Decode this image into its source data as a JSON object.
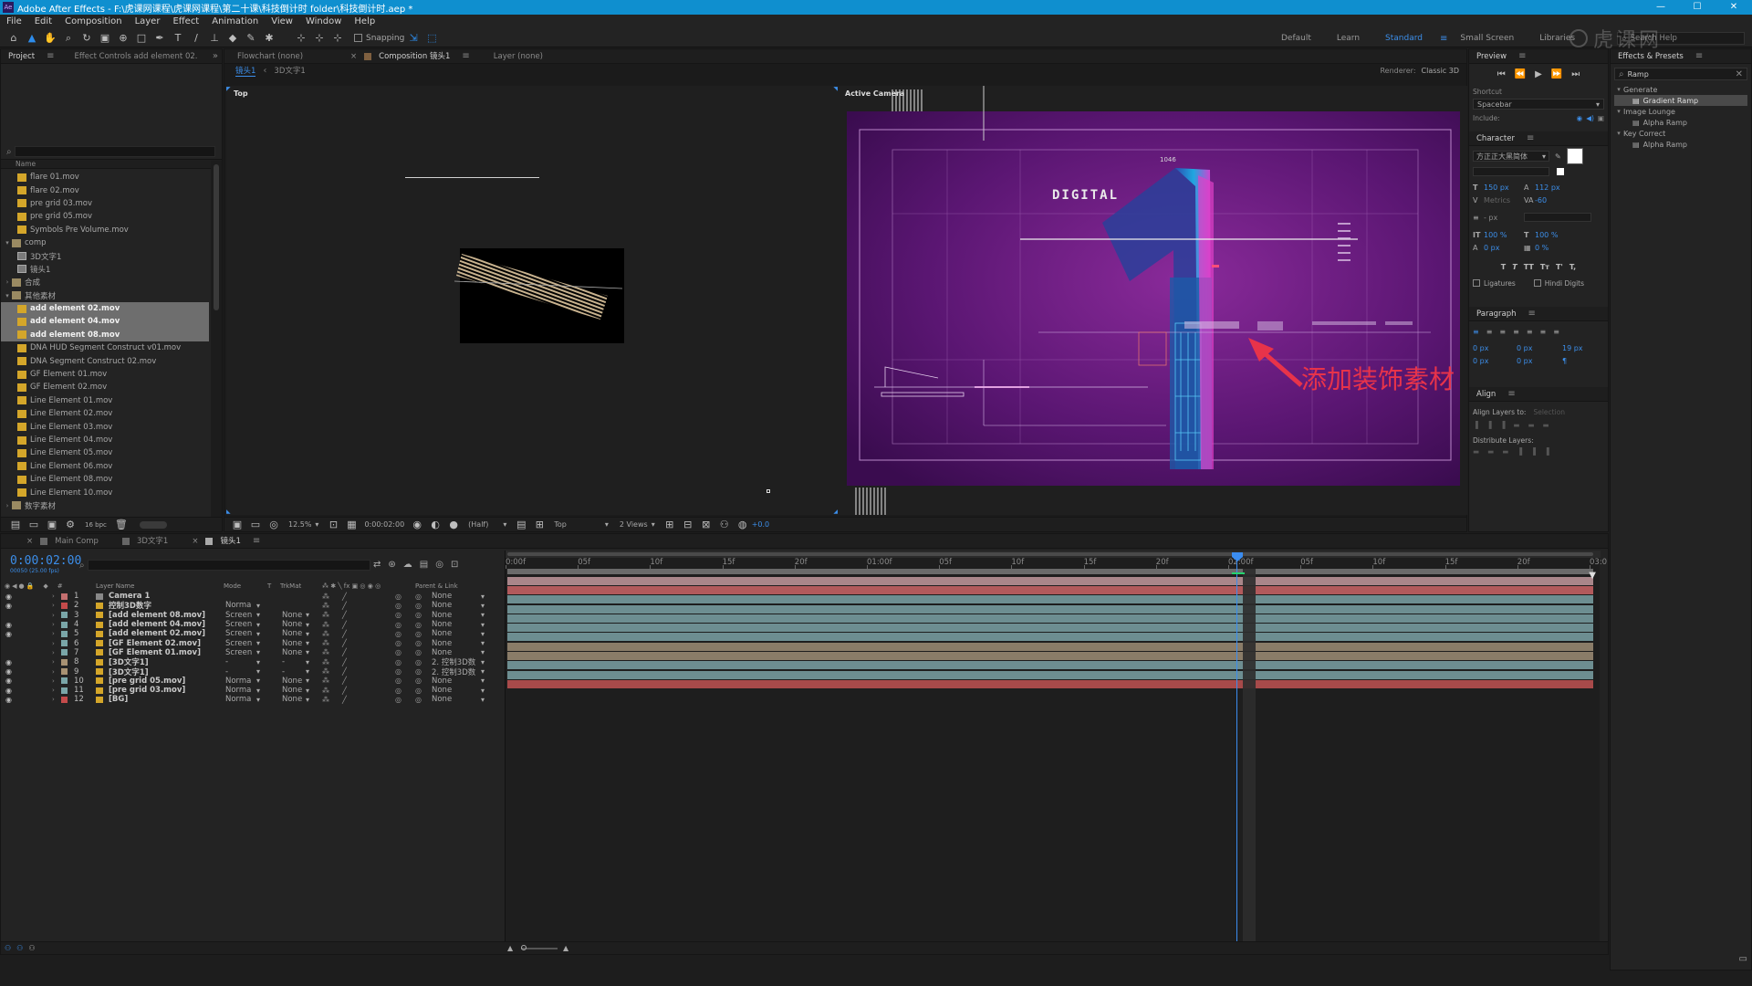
{
  "window": {
    "title": "Adobe After Effects - F:\\虎课网课程\\虎课网课程\\第二十课\\科技倒计时 folder\\科技倒计时.aep *",
    "app_badge": "Ae",
    "min": "—",
    "max": "☐",
    "close": "✕"
  },
  "menu": [
    "File",
    "Edit",
    "Composition",
    "Layer",
    "Effect",
    "Animation",
    "View",
    "Window",
    "Help"
  ],
  "toolbar": {
    "snapping_label": "Snapping",
    "workspaces": [
      "Default",
      "Learn",
      "Standard",
      "Small Screen",
      "Libraries"
    ],
    "active_workspace": "Standard",
    "search_help": "Search Help"
  },
  "project_panel": {
    "tabs": [
      "Project",
      "Effect Controls add element 02."
    ],
    "search_placeholder": "",
    "column_name": "Name",
    "items": [
      {
        "label": "flare 01.mov",
        "type": "mov",
        "indent": 2,
        "selected": false
      },
      {
        "label": "flare 02.mov",
        "type": "mov",
        "indent": 2,
        "selected": false
      },
      {
        "label": "pre grid 03.mov",
        "type": "mov",
        "indent": 2,
        "selected": false
      },
      {
        "label": "pre grid 05.mov",
        "type": "mov",
        "indent": 2,
        "selected": false
      },
      {
        "label": "Symbols Pre Volume.mov",
        "type": "mov",
        "indent": 2,
        "selected": false
      },
      {
        "label": "comp",
        "type": "folder",
        "indent": 0,
        "selected": false,
        "expanded": true
      },
      {
        "label": "3D文字1",
        "type": "comp",
        "indent": 2,
        "selected": false
      },
      {
        "label": "镜头1",
        "type": "comp",
        "indent": 2,
        "selected": false
      },
      {
        "label": "合成",
        "type": "folder",
        "indent": 0,
        "selected": false,
        "expanded": false
      },
      {
        "label": "其他素材",
        "type": "folder",
        "indent": 0,
        "selected": false,
        "expanded": true
      },
      {
        "label": "add element 02.mov",
        "type": "mov",
        "indent": 2,
        "selected": true
      },
      {
        "label": "add element 04.mov",
        "type": "mov",
        "indent": 2,
        "selected": true
      },
      {
        "label": "add element 08.mov",
        "type": "mov",
        "indent": 2,
        "selected": true
      },
      {
        "label": "DNA HUD Segment Construct v01.mov",
        "type": "mov",
        "indent": 2,
        "selected": false
      },
      {
        "label": "DNA Segment Construct 02.mov",
        "type": "mov",
        "indent": 2,
        "selected": false
      },
      {
        "label": "GF Element 01.mov",
        "type": "mov",
        "indent": 2,
        "selected": false
      },
      {
        "label": "GF Element 02.mov",
        "type": "mov",
        "indent": 2,
        "selected": false
      },
      {
        "label": "Line Element 01.mov",
        "type": "mov",
        "indent": 2,
        "selected": false
      },
      {
        "label": "Line Element 02.mov",
        "type": "mov",
        "indent": 2,
        "selected": false
      },
      {
        "label": "Line Element 03.mov",
        "type": "mov",
        "indent": 2,
        "selected": false
      },
      {
        "label": "Line Element 04.mov",
        "type": "mov",
        "indent": 2,
        "selected": false
      },
      {
        "label": "Line Element 05.mov",
        "type": "mov",
        "indent": 2,
        "selected": false
      },
      {
        "label": "Line Element 06.mov",
        "type": "mov",
        "indent": 2,
        "selected": false
      },
      {
        "label": "Line Element 08.mov",
        "type": "mov",
        "indent": 2,
        "selected": false
      },
      {
        "label": "Line Element 10.mov",
        "type": "mov",
        "indent": 2,
        "selected": false
      },
      {
        "label": "数字素材",
        "type": "folder",
        "indent": 0,
        "selected": false,
        "expanded": false
      }
    ],
    "bpc": "16 bpc"
  },
  "viewer": {
    "tabs": [
      "Flowchart (none)",
      "Composition 镜头1",
      "Layer (none)"
    ],
    "breadcrumbs": [
      "镜头1",
      "3D文字1"
    ],
    "renderer_label": "Renderer:",
    "renderer_value": "Classic 3D",
    "left_view_label": "Top",
    "right_view_label": "Active Camera",
    "digital_text": "DIGITAL",
    "hud_number": "1046",
    "annotation": "添加装饰素材",
    "footer": {
      "zoom": "12.5%",
      "timecode": "0:00:02:00",
      "resolution": "(Half)",
      "view": "Top",
      "views": "2 Views",
      "exposure": "+0.0"
    }
  },
  "timeline": {
    "tabs": [
      "Main Comp",
      "3D文字1",
      "镜头1"
    ],
    "timecode": "0:00:02:00",
    "timecode_sub": "00050 (25.00 fps)",
    "columns": {
      "layer_name": "Layer Name",
      "mode": "Mode",
      "t": "T",
      "trkmat": "TrkMat",
      "parent": "Parent & Link"
    },
    "ruler": [
      "0:00f",
      "05f",
      "10f",
      "15f",
      "20f",
      "01:00f",
      "05f",
      "10f",
      "15f",
      "20f",
      "02:00f",
      "05f",
      "10f",
      "15f",
      "20f",
      "03:0"
    ],
    "layers": [
      {
        "num": "1",
        "name": "Camera 1",
        "mode": "",
        "trkmat": "",
        "parent": "None",
        "color": "#c46f6f",
        "bar": "#a9868a",
        "visible": true
      },
      {
        "num": "2",
        "name": "控制3D数字",
        "mode": "Norma",
        "trkmat": "",
        "parent": "None",
        "color": "#c44b4b",
        "bar": "#b25a5c",
        "visible": true
      },
      {
        "num": "3",
        "name": "[add element 08.mov]",
        "mode": "Screen",
        "trkmat": "None",
        "parent": "None",
        "color": "#7aa6a8",
        "bar": "#6d8e91",
        "visible": false
      },
      {
        "num": "4",
        "name": "[add element 04.mov]",
        "mode": "Screen",
        "trkmat": "None",
        "parent": "None",
        "color": "#7aa6a8",
        "bar": "#6d8e91",
        "visible": true
      },
      {
        "num": "5",
        "name": "[add element 02.mov]",
        "mode": "Screen",
        "trkmat": "None",
        "parent": "None",
        "color": "#7aa6a8",
        "bar": "#6d8e91",
        "visible": true
      },
      {
        "num": "6",
        "name": "[GF Element 02.mov]",
        "mode": "Screen",
        "trkmat": "None",
        "parent": "None",
        "color": "#7aa6a8",
        "bar": "#6d8e91",
        "visible": false
      },
      {
        "num": "7",
        "name": "[GF Element 01.mov]",
        "mode": "Screen",
        "trkmat": "None",
        "parent": "None",
        "color": "#7aa6a8",
        "bar": "#6d8e91",
        "visible": false
      },
      {
        "num": "8",
        "name": "[3D文字1]",
        "mode": "-",
        "trkmat": "-",
        "parent": "2. 控制3D数",
        "color": "#a89273",
        "bar": "#8a7c68",
        "visible": true
      },
      {
        "num": "9",
        "name": "[3D文字1]",
        "mode": "-",
        "trkmat": "-",
        "parent": "2. 控制3D数",
        "color": "#a89273",
        "bar": "#8a7c68",
        "visible": true
      },
      {
        "num": "10",
        "name": "[pre grid 05.mov]",
        "mode": "Norma",
        "trkmat": "None",
        "parent": "None",
        "color": "#7aa6a8",
        "bar": "#6d8e91",
        "visible": true
      },
      {
        "num": "11",
        "name": "[pre grid 03.mov]",
        "mode": "Norma",
        "trkmat": "None",
        "parent": "None",
        "color": "#7aa6a8",
        "bar": "#6d8e91",
        "visible": true
      },
      {
        "num": "12",
        "name": "[BG]",
        "mode": "Norma",
        "trkmat": "None",
        "parent": "None",
        "color": "#c44b4b",
        "bar": "#a84a4a",
        "visible": true
      }
    ]
  },
  "preview": {
    "title": "Preview",
    "shortcut_label": "Shortcut",
    "shortcut_value": "Spacebar",
    "include_label": "Include:"
  },
  "character": {
    "title": "Character",
    "font": "方正正大黑简体",
    "size": "150 px",
    "leading": "112 px",
    "kerning": "Metrics",
    "tracking": "-60",
    "stroke": "- px",
    "vscale": "100 %",
    "hscale": "100 %",
    "baseline": "0 px",
    "tsume": "0 %",
    "styles": [
      "T",
      "T",
      "TT",
      "Tт",
      "T'",
      "T,"
    ],
    "ligatures": "Ligatures",
    "hindi": "Hindi Digits"
  },
  "paragraph": {
    "title": "Paragraph",
    "v1": "0 px",
    "v2": "0 px",
    "v3": "19 px",
    "v4": "0 px",
    "v5": "0 px"
  },
  "align": {
    "title": "Align",
    "align_to": "Align Layers to:",
    "align_to_value": "Selection",
    "distribute": "Distribute Layers:"
  },
  "effects": {
    "title": "Effects & Presets",
    "search": "Ramp",
    "groups": [
      {
        "label": "Generate",
        "items": [
          "Gradient Ramp"
        ]
      },
      {
        "label": "Image Lounge",
        "items": [
          "Alpha Ramp"
        ]
      },
      {
        "label": "Key Correct",
        "items": [
          "Alpha Ramp"
        ]
      }
    ]
  },
  "colors": {
    "accent": "#2d8ceb",
    "titlebar": "#0f8fcf",
    "annotation": "#e8334a",
    "playhead": "#3b8df0"
  },
  "watermark": "虎课网"
}
